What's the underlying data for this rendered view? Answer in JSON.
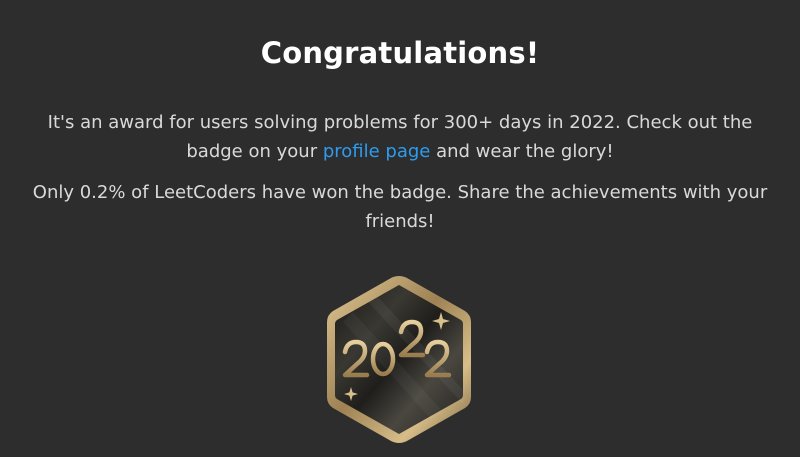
{
  "dialog": {
    "title": "Congratulations!",
    "paragraph1": {
      "line1": "It's an award for users solving problems for 300+ days in 2022. Check out the",
      "line2_before": "badge on your ",
      "link": "profile page",
      "line2_after": " and wear the glory!"
    },
    "paragraph2": {
      "line1": "Only 0.2% of LeetCoders have won the badge. Share the achievements with your",
      "line2": "friends!"
    }
  },
  "badge": {
    "label": "2022",
    "icon": "hexagon-2022-badge-icon",
    "colors": {
      "gold": "#b89a6a",
      "gold_light": "#e0c894",
      "face_dark": "#1d1d1b",
      "face_light": "#4a4740"
    }
  },
  "colors": {
    "background": "#2d2d2d",
    "title": "#ffffff",
    "text": "#d9d9d9",
    "link": "#2d9cf0"
  }
}
